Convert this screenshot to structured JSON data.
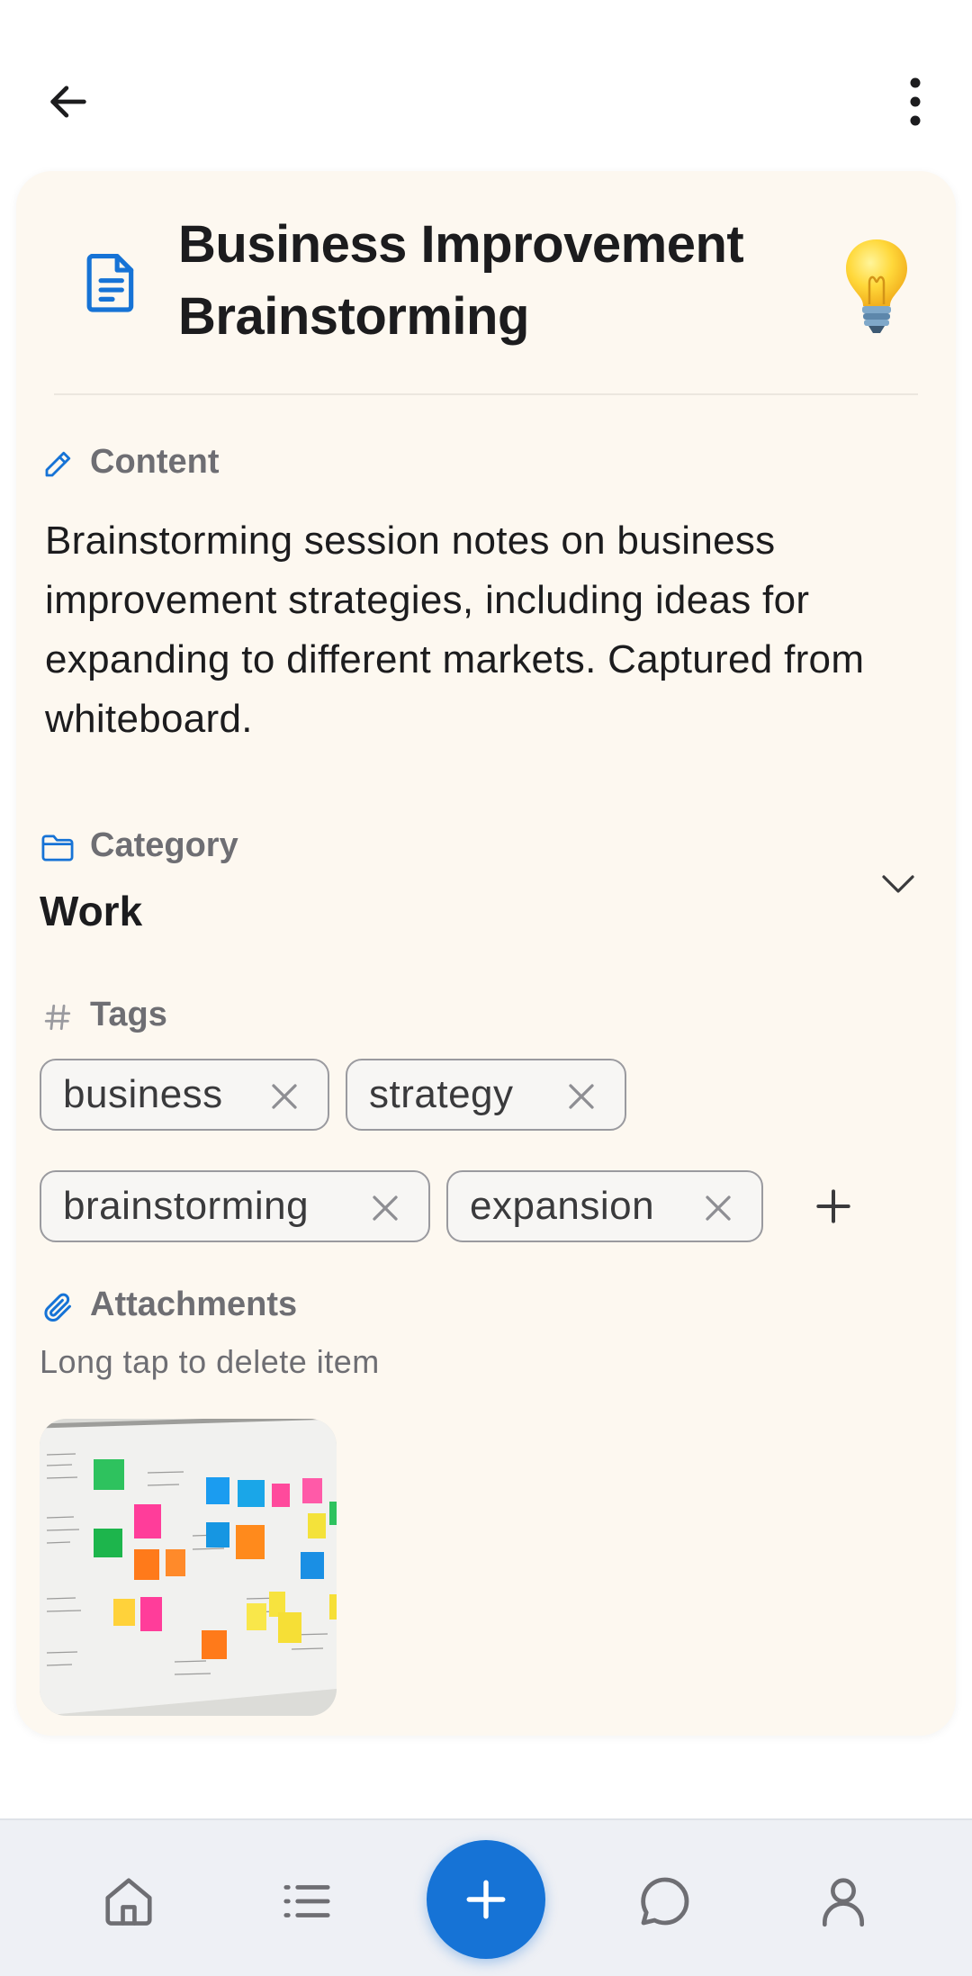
{
  "header": {
    "back_icon": "arrow-left-icon",
    "more_icon": "more-vertical-icon"
  },
  "note": {
    "title_line1": "Business Improvement",
    "title_line2": "Brainstorming",
    "doc_icon": "document-icon",
    "emoji_icon": "lightbulb-icon",
    "content_label": "Content",
    "content": "Brainstorming session notes on business improvement strategies, including ideas for expanding to different markets. Captured from whiteboard.",
    "category_label": "Category",
    "category_value": "Work",
    "tags_label": "Tags",
    "tags": [
      "business",
      "strategy",
      "brainstorming",
      "expansion"
    ],
    "attachments_label": "Attachments",
    "attachments_hint": "Long tap to delete item",
    "attachment_icon": "whiteboard-photo"
  },
  "colors": {
    "accent": "#1673d6",
    "card_bg": "#fdf8f0",
    "nav_bg": "#eef0f5",
    "text_primary": "#1c1c1e",
    "text_secondary": "#6e6e73"
  },
  "bottom_nav": {
    "items": [
      "home-icon",
      "list-icon",
      "add-icon",
      "chat-icon",
      "profile-icon"
    ]
  }
}
